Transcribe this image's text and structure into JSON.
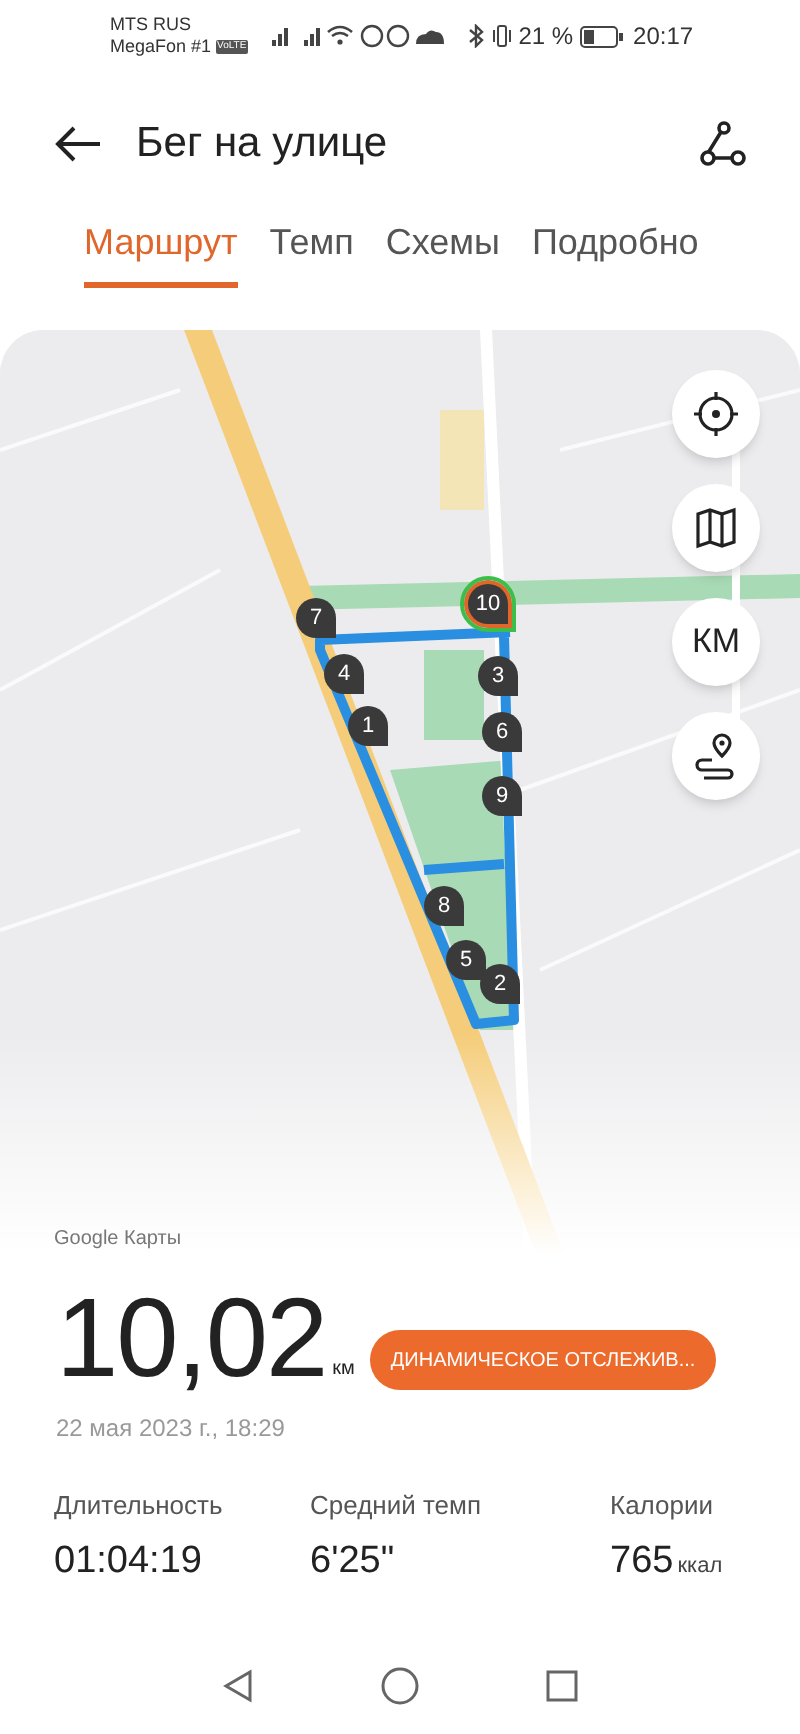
{
  "status_bar": {
    "carrier_1": "MTS RUS",
    "carrier_2": "MegaFon #1",
    "volte_badge": "VoLTE",
    "battery_percent": "21 %",
    "time": "20:17"
  },
  "header": {
    "title": "Бег на улице"
  },
  "tabs": [
    {
      "label": "Маршрут",
      "selected": true
    },
    {
      "label": "Темп",
      "selected": false
    },
    {
      "label": "Схемы",
      "selected": false
    },
    {
      "label": "Подробно",
      "selected": false
    }
  ],
  "map": {
    "markers": [
      {
        "label": "7"
      },
      {
        "label": "10",
        "kind": "finish"
      },
      {
        "label": "4"
      },
      {
        "label": "3"
      },
      {
        "label": "1"
      },
      {
        "label": "6"
      },
      {
        "label": "9"
      },
      {
        "label": "8"
      },
      {
        "label": "5"
      },
      {
        "label": "2"
      }
    ],
    "unit_button": "КМ",
    "attribution": "Google Карты"
  },
  "summary": {
    "distance": "10,02",
    "unit": "км",
    "tracking_button": "ДИНАМИЧЕСКОЕ ОТСЛЕЖИВ...",
    "date": "22 мая 2023 г., 18:29"
  },
  "stats": [
    {
      "label": "Длительность",
      "value": "01:04:19"
    },
    {
      "label": "Средний темп",
      "value": "6'25\""
    },
    {
      "label": "Калории",
      "value": "765",
      "unit": "ккал"
    }
  ]
}
